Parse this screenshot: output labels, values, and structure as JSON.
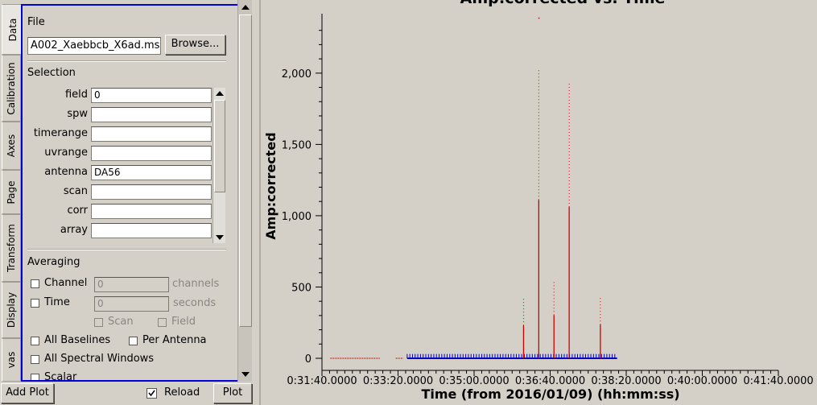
{
  "tabs": [
    "Data",
    "Calibration",
    "Axes",
    "Page",
    "Transform",
    "Display",
    "vas"
  ],
  "file": {
    "heading": "File",
    "value": "A002_Xaebbcb_X6ad.ms",
    "browse_label": "Browse..."
  },
  "selection": {
    "heading": "Selection",
    "fields": [
      {
        "label": "field",
        "value": "0"
      },
      {
        "label": "spw",
        "value": ""
      },
      {
        "label": "timerange",
        "value": ""
      },
      {
        "label": "uvrange",
        "value": ""
      },
      {
        "label": "antenna",
        "value": "DA56"
      },
      {
        "label": "scan",
        "value": ""
      },
      {
        "label": "corr",
        "value": ""
      },
      {
        "label": "array",
        "value": ""
      }
    ]
  },
  "averaging": {
    "heading": "Averaging",
    "channel": {
      "label": "Channel",
      "value": "0",
      "unit": "channels",
      "checked": false
    },
    "time": {
      "label": "Time",
      "value": "0",
      "unit": "seconds",
      "checked": false
    },
    "scan_label": "Scan",
    "field_label": "Field",
    "all_baselines": "All Baselines",
    "per_antenna": "Per Antenna",
    "all_spw": "All Spectral Windows",
    "scalar": "Scalar"
  },
  "bottom": {
    "add_plot": "Add Plot",
    "reload": "Reload",
    "reload_checked": true,
    "plot": "Plot"
  },
  "colors": {
    "tab_border": "#0000d8",
    "series_red": "#d00000",
    "series_blue": "#0000c8",
    "bg": "#d4d0c8"
  },
  "chart_data": {
    "type": "scatter",
    "title": "Amp:corrected vs. Time",
    "xlabel": "Time (from 2016/01/09) (hh:mm:ss)",
    "ylabel": "Amp:corrected",
    "x_ticks": [
      "0:31:40.0000",
      "0:33:20.0000",
      "0:35:00.0000",
      "0:36:40.0000",
      "0:38:20.0000",
      "0:40:00.0000",
      "0:41:40.0000"
    ],
    "x_range_seconds": [
      1900,
      2500
    ],
    "y_ticks": [
      "0",
      "500",
      "1,000",
      "1,500",
      "2,000"
    ],
    "y_tick_values": [
      0,
      500,
      1000,
      1500,
      2000
    ],
    "y_range": [
      -30,
      2400
    ],
    "grid": false,
    "series": [
      {
        "color": "#d00000",
        "segments": [
          [
            1911,
            1976
          ],
          [
            1997,
            2007
          ]
        ],
        "spikes": [
          {
            "x": 2165,
            "max": 420
          },
          {
            "x": 2185,
            "max": 2020
          },
          {
            "x": 2205,
            "max": 550
          },
          {
            "x": 2225,
            "max": 1930
          },
          {
            "x": 2266,
            "max": 430
          }
        ],
        "outlier": {
          "x": 2185,
          "y": 2390
        }
      },
      {
        "color": "#0000c8",
        "x_start": 2012,
        "x_end": 2288,
        "max": 30
      }
    ]
  }
}
